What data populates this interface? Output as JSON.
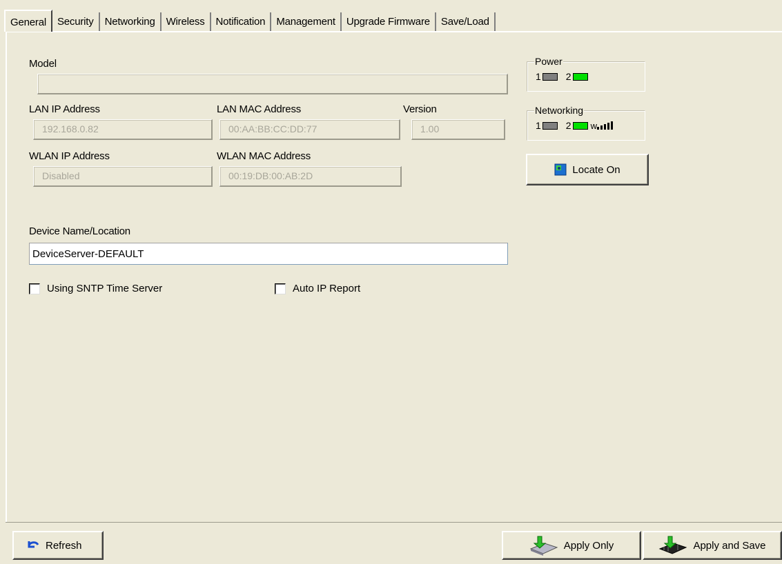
{
  "tabs": [
    {
      "label": "General",
      "active": true
    },
    {
      "label": "Security"
    },
    {
      "label": "Networking"
    },
    {
      "label": "Wireless"
    },
    {
      "label": "Notification"
    },
    {
      "label": "Management"
    },
    {
      "label": "Upgrade Firmware"
    },
    {
      "label": "Save/Load"
    }
  ],
  "general": {
    "model_label": "Model",
    "model_value": "",
    "lan_ip_label": "LAN IP Address",
    "lan_ip_value": "192.168.0.82",
    "lan_mac_label": "LAN MAC Address",
    "lan_mac_value": "00:AA:BB:CC:DD:77",
    "version_label": "Version",
    "version_value": "1.00",
    "wlan_ip_label": "WLAN IP Address",
    "wlan_ip_value": "Disabled",
    "wlan_mac_label": "WLAN MAC Address",
    "wlan_mac_value": "00:19:DB:00:AB:2D",
    "device_name_label": "Device Name/Location",
    "device_name_value": "DeviceServer-DEFAULT",
    "sntp_label": "Using SNTP Time Server",
    "sntp_checked": false,
    "autoip_label": "Auto IP Report",
    "autoip_checked": false
  },
  "status": {
    "power_title": "Power",
    "power_led1_label": "1",
    "power_led2_label": "2",
    "power_led1_color": "#808080",
    "power_led2_color": "#00e000",
    "networking_title": "Networking",
    "net_led1_label": "1",
    "net_led2_label": "2",
    "net_led1_color": "#808080",
    "net_led2_color": "#00e000",
    "wlan_signal_label": "w",
    "locate_label": "Locate On"
  },
  "footer": {
    "refresh_label": "Refresh",
    "apply_only_label": "Apply Only",
    "apply_save_label": "Apply and Save"
  }
}
